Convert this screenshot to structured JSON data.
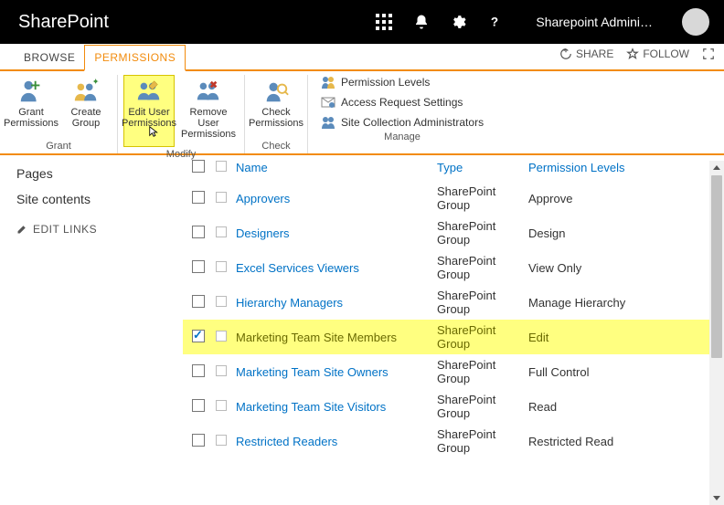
{
  "topbar": {
    "brand": "SharePoint",
    "user": "Sharepoint Admini…"
  },
  "tabs": {
    "browse": "BROWSE",
    "permissions": "PERMISSIONS"
  },
  "strip": {
    "share": "SHARE",
    "follow": "FOLLOW"
  },
  "ribbon": {
    "grant_label": "Grant",
    "modify_label": "Modify",
    "check_label": "Check",
    "manage_label": "Manage",
    "grant_perm_l1": "Grant",
    "grant_perm_l2": "Permissions",
    "create_group_l1": "Create",
    "create_group_l2": "Group",
    "edit_user_l1": "Edit User",
    "edit_user_l2": "Permissions",
    "remove_user_l1": "Remove User",
    "remove_user_l2": "Permissions",
    "check_perm_l1": "Check",
    "check_perm_l2": "Permissions",
    "manage_perm_levels": "Permission Levels",
    "manage_access_req": "Access Request Settings",
    "manage_site_admins": "Site Collection Administrators"
  },
  "leftnav": {
    "pages": "Pages",
    "site_contents": "Site contents",
    "edit_links": "EDIT LINKS"
  },
  "columns": {
    "name": "Name",
    "type": "Type",
    "perm": "Permission Levels"
  },
  "groups": [
    {
      "name": "Approvers",
      "type": "SharePoint Group",
      "perm": "Approve",
      "checked": false,
      "hl": false
    },
    {
      "name": "Designers",
      "type": "SharePoint Group",
      "perm": "Design",
      "checked": false,
      "hl": false
    },
    {
      "name": "Excel Services Viewers",
      "type": "SharePoint Group",
      "perm": "View Only",
      "checked": false,
      "hl": false
    },
    {
      "name": "Hierarchy Managers",
      "type": "SharePoint Group",
      "perm": "Manage Hierarchy",
      "checked": false,
      "hl": false
    },
    {
      "name": "Marketing Team Site Members",
      "type": "SharePoint Group",
      "perm": "Edit",
      "checked": true,
      "hl": true
    },
    {
      "name": "Marketing Team Site Owners",
      "type": "SharePoint Group",
      "perm": "Full Control",
      "checked": false,
      "hl": false
    },
    {
      "name": "Marketing Team Site Visitors",
      "type": "SharePoint Group",
      "perm": "Read",
      "checked": false,
      "hl": false
    },
    {
      "name": "Restricted Readers",
      "type": "SharePoint Group",
      "perm": "Restricted Read",
      "checked": false,
      "hl": false
    }
  ]
}
